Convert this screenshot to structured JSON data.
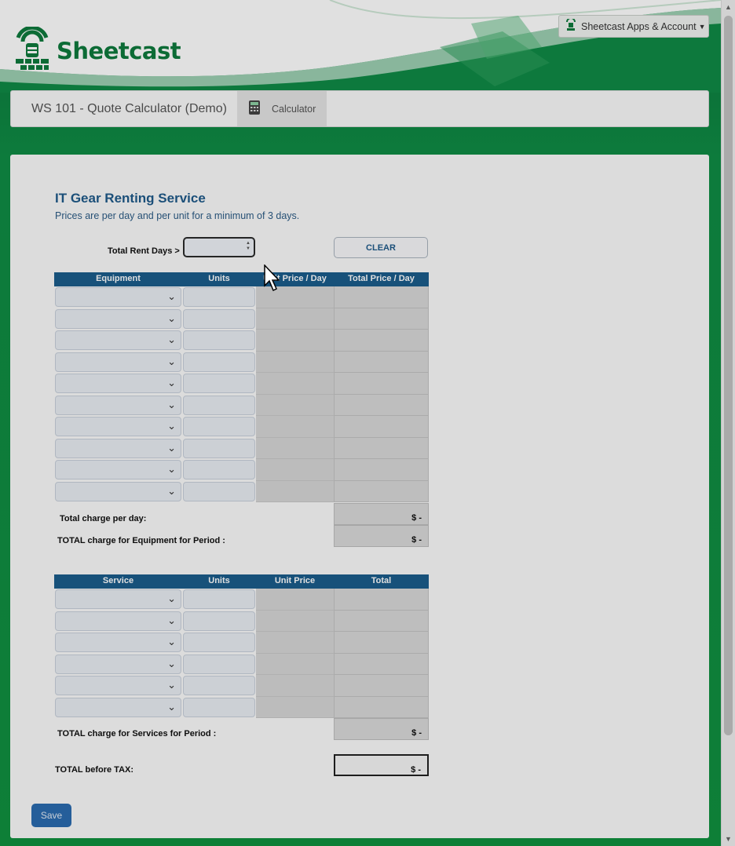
{
  "brand": {
    "name": "Sheetcast",
    "account_menu": "Sheetcast Apps & Account"
  },
  "nav": {
    "title": "WS 101 - Quote Calculator (Demo)",
    "tab_label": "Calculator"
  },
  "form": {
    "title": "IT Gear Renting Service",
    "subtitle": "Prices are per day and per unit for a minimum of 3 days.",
    "days_label": "Total Rent Days >",
    "clear_label": "CLEAR"
  },
  "equipment_table": {
    "headers": [
      "Equipment",
      "Units",
      "Unit Price / Day",
      "Total Price / Day"
    ],
    "row_count": 10,
    "total_per_day_label": "Total charge per day:",
    "total_per_day_value": "$ -",
    "total_period_label": "TOTAL charge for Equipment for Period :",
    "total_period_value": "$ -"
  },
  "service_table": {
    "headers": [
      "Service",
      "Units",
      "Unit Price",
      "Total"
    ],
    "row_count": 6,
    "total_period_label": "TOTAL charge for Services for Period :",
    "total_period_value": "$ -"
  },
  "grand_total": {
    "label": "TOTAL before TAX:",
    "value": "$ -"
  },
  "save_label": "Save",
  "colors": {
    "brand_green": "#0e7a3d",
    "header_blue": "#1b5d8b",
    "title_blue": "#1f5a8a",
    "save_blue": "#2b6cb0"
  }
}
